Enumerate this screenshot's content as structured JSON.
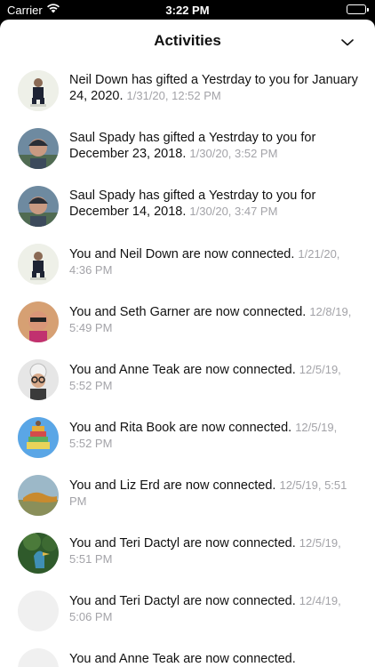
{
  "status_bar": {
    "carrier": "Carrier",
    "time": "3:22 PM"
  },
  "header": {
    "title": "Activities"
  },
  "activities": [
    {
      "name": "Neil Down",
      "message": "has gifted a Yestrday to you for January 24, 2020.",
      "timestamp": "1/31/20, 12:52 PM",
      "avatar": "man-in-suit-avatar"
    },
    {
      "name": "Saul Spady",
      "message": "has gifted a Yestrday to you for December 23, 2018.",
      "timestamp": "1/30/20, 3:52 PM",
      "avatar": "man-with-beanie-avatar"
    },
    {
      "name": "Saul Spady",
      "message": "has gifted a Yestrday to you for December 14, 2018.",
      "timestamp": "1/30/20, 3:47 PM",
      "avatar": "man-with-beanie-avatar"
    },
    {
      "name": "",
      "message": "You and Neil Down are now connected.",
      "timestamp": "1/21/20, 4:36 PM",
      "avatar": "man-in-suit-avatar"
    },
    {
      "name": "",
      "message": "You and Seth Garner are now connected.",
      "timestamp": "12/8/19, 5:49 PM",
      "avatar": "man-with-sunglasses-avatar"
    },
    {
      "name": "",
      "message": "You and Anne Teak are now connected.",
      "timestamp": "12/5/19, 5:52 PM",
      "avatar": "woman-with-glasses-avatar"
    },
    {
      "name": "",
      "message": "You and Rita Book are now connected.",
      "timestamp": "12/5/19, 5:52 PM",
      "avatar": "stacked-figure-avatar"
    },
    {
      "name": "",
      "message": "You and Liz Erd are now connected.",
      "timestamp": "12/5/19, 5:51 PM",
      "avatar": "lizard-avatar"
    },
    {
      "name": "",
      "message": "You and Teri Dactyl are now connected.",
      "timestamp": "12/5/19, 5:51 PM",
      "avatar": "bird-avatar"
    },
    {
      "name": "",
      "message": "You and Teri Dactyl are now connected.",
      "timestamp": "12/4/19, 5:06 PM",
      "avatar": "placeholder-avatar"
    },
    {
      "name": "",
      "message": "You and Anne Teak are now connected.",
      "timestamp": "",
      "avatar": "placeholder-avatar"
    }
  ]
}
